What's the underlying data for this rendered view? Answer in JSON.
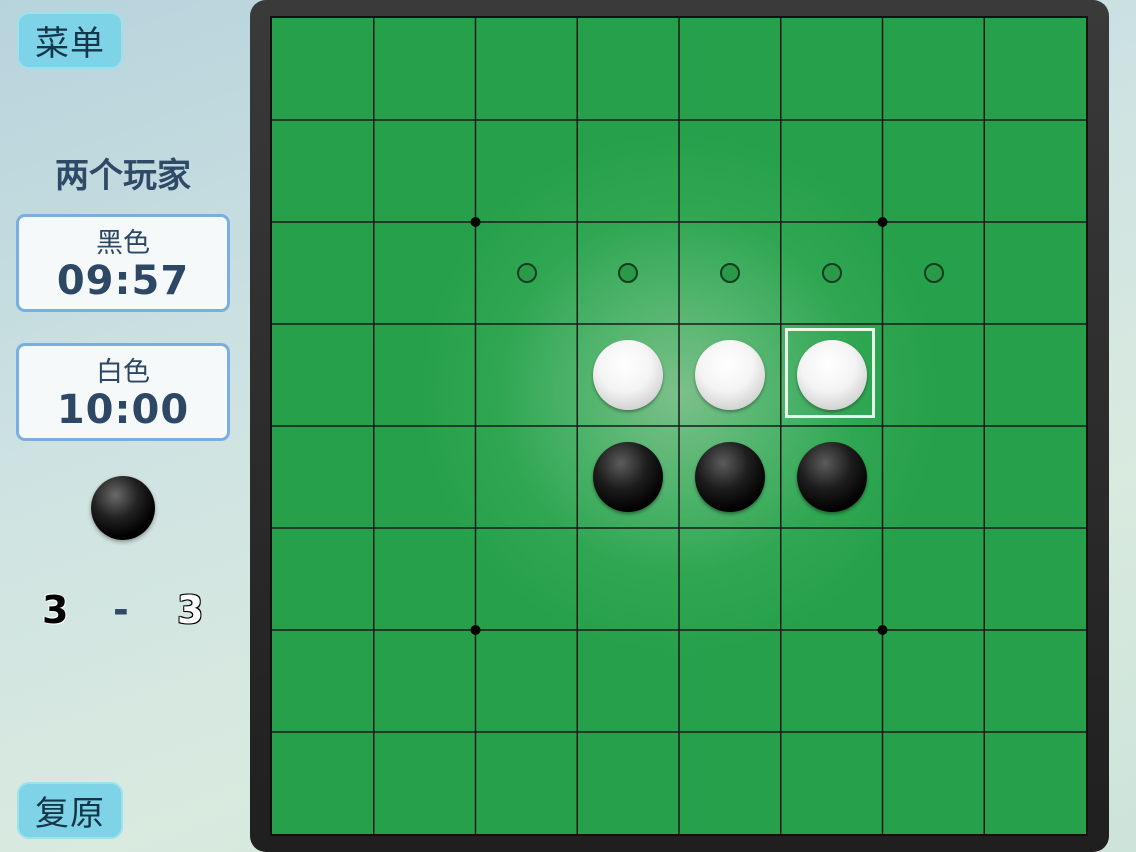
{
  "menu_button": "菜单",
  "undo_button": "复原",
  "mode_title": "两个玩家",
  "clocks": {
    "black": {
      "label": "黑色",
      "time": "09:57"
    },
    "white": {
      "label": "白色",
      "time": "10:00"
    }
  },
  "current_turn": "black",
  "score": {
    "black": "3",
    "dash": "-",
    "white": "3"
  },
  "board": {
    "size": 8,
    "stones": [
      {
        "row": 3,
        "col": 3,
        "color": "white"
      },
      {
        "row": 3,
        "col": 4,
        "color": "white"
      },
      {
        "row": 3,
        "col": 5,
        "color": "white"
      },
      {
        "row": 4,
        "col": 3,
        "color": "black"
      },
      {
        "row": 4,
        "col": 4,
        "color": "black"
      },
      {
        "row": 4,
        "col": 5,
        "color": "black"
      }
    ],
    "hints": [
      {
        "row": 2,
        "col": 2
      },
      {
        "row": 2,
        "col": 3
      },
      {
        "row": 2,
        "col": 4
      },
      {
        "row": 2,
        "col": 5
      },
      {
        "row": 2,
        "col": 6
      }
    ],
    "last_move": {
      "row": 3,
      "col": 5
    },
    "colors": {
      "felt": "#27a04c",
      "frame": "#2a2a2a"
    }
  }
}
